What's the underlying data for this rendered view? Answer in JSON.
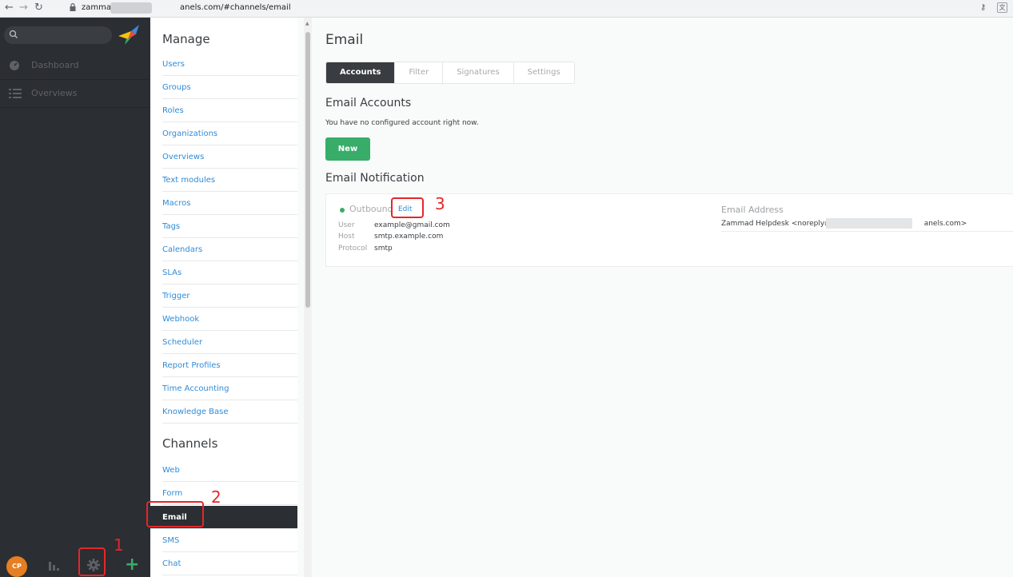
{
  "browser": {
    "url_prefix": "zamma",
    "url_suffix": "anels.com/#channels/email"
  },
  "sidebar": {
    "search_placeholder": "",
    "items": [
      {
        "label": "Dashboard",
        "icon": "dashboard-icon"
      },
      {
        "label": "Overviews",
        "icon": "overviews-icon"
      }
    ],
    "avatar_initials": "CP"
  },
  "admin_menu": {
    "manage_title": "Manage",
    "manage_items": [
      "Users",
      "Groups",
      "Roles",
      "Organizations",
      "Overviews",
      "Text modules",
      "Macros",
      "Tags",
      "Calendars",
      "SLAs",
      "Trigger",
      "Webhook",
      "Scheduler",
      "Report Profiles",
      "Time Accounting",
      "Knowledge Base"
    ],
    "channels_title": "Channels",
    "channels_items": [
      "Web",
      "Form",
      "Email",
      "SMS",
      "Chat"
    ],
    "active_item": "Email"
  },
  "main": {
    "title": "Email",
    "tabs": [
      "Accounts",
      "Filter",
      "Signatures",
      "Settings"
    ],
    "active_tab": "Accounts",
    "accounts_heading": "Email Accounts",
    "accounts_text": "You have no configured account right now.",
    "new_button": "New",
    "notification_heading": "Email Notification",
    "outbound": {
      "label": "Outbound",
      "edit": "Edit",
      "user_key": "User",
      "user_val": "example@gmail.com",
      "host_key": "Host",
      "host_val": "smtp.example.com",
      "protocol_key": "Protocol",
      "protocol_val": "smtp"
    },
    "email_address_heading": "Email Address",
    "email_address_value": "Zammad Helpdesk <noreply@a",
    "email_address_suffix": "anels.com>"
  },
  "annotations": {
    "step1": "1",
    "step2": "2",
    "step3": "3"
  },
  "colors": {
    "accent_green": "#38ad69",
    "link_blue": "#2f8bd8",
    "sidebar_dark": "#2b2e32",
    "annotation_red": "#e5262a"
  }
}
